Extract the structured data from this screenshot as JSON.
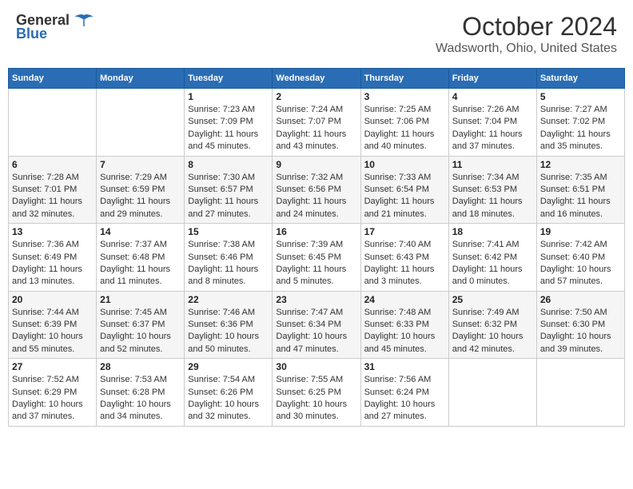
{
  "header": {
    "logo_general": "General",
    "logo_blue": "Blue",
    "month": "October 2024",
    "location": "Wadsworth, Ohio, United States"
  },
  "weekdays": [
    "Sunday",
    "Monday",
    "Tuesday",
    "Wednesday",
    "Thursday",
    "Friday",
    "Saturday"
  ],
  "weeks": [
    [
      null,
      null,
      {
        "day": "1",
        "sunrise": "7:23 AM",
        "sunset": "7:09 PM",
        "daylight": "11 hours and 45 minutes."
      },
      {
        "day": "2",
        "sunrise": "7:24 AM",
        "sunset": "7:07 PM",
        "daylight": "11 hours and 43 minutes."
      },
      {
        "day": "3",
        "sunrise": "7:25 AM",
        "sunset": "7:06 PM",
        "daylight": "11 hours and 40 minutes."
      },
      {
        "day": "4",
        "sunrise": "7:26 AM",
        "sunset": "7:04 PM",
        "daylight": "11 hours and 37 minutes."
      },
      {
        "day": "5",
        "sunrise": "7:27 AM",
        "sunset": "7:02 PM",
        "daylight": "11 hours and 35 minutes."
      }
    ],
    [
      {
        "day": "6",
        "sunrise": "7:28 AM",
        "sunset": "7:01 PM",
        "daylight": "11 hours and 32 minutes."
      },
      {
        "day": "7",
        "sunrise": "7:29 AM",
        "sunset": "6:59 PM",
        "daylight": "11 hours and 29 minutes."
      },
      {
        "day": "8",
        "sunrise": "7:30 AM",
        "sunset": "6:57 PM",
        "daylight": "11 hours and 27 minutes."
      },
      {
        "day": "9",
        "sunrise": "7:32 AM",
        "sunset": "6:56 PM",
        "daylight": "11 hours and 24 minutes."
      },
      {
        "day": "10",
        "sunrise": "7:33 AM",
        "sunset": "6:54 PM",
        "daylight": "11 hours and 21 minutes."
      },
      {
        "day": "11",
        "sunrise": "7:34 AM",
        "sunset": "6:53 PM",
        "daylight": "11 hours and 18 minutes."
      },
      {
        "day": "12",
        "sunrise": "7:35 AM",
        "sunset": "6:51 PM",
        "daylight": "11 hours and 16 minutes."
      }
    ],
    [
      {
        "day": "13",
        "sunrise": "7:36 AM",
        "sunset": "6:49 PM",
        "daylight": "11 hours and 13 minutes."
      },
      {
        "day": "14",
        "sunrise": "7:37 AM",
        "sunset": "6:48 PM",
        "daylight": "11 hours and 11 minutes."
      },
      {
        "day": "15",
        "sunrise": "7:38 AM",
        "sunset": "6:46 PM",
        "daylight": "11 hours and 8 minutes."
      },
      {
        "day": "16",
        "sunrise": "7:39 AM",
        "sunset": "6:45 PM",
        "daylight": "11 hours and 5 minutes."
      },
      {
        "day": "17",
        "sunrise": "7:40 AM",
        "sunset": "6:43 PM",
        "daylight": "11 hours and 3 minutes."
      },
      {
        "day": "18",
        "sunrise": "7:41 AM",
        "sunset": "6:42 PM",
        "daylight": "11 hours and 0 minutes."
      },
      {
        "day": "19",
        "sunrise": "7:42 AM",
        "sunset": "6:40 PM",
        "daylight": "10 hours and 57 minutes."
      }
    ],
    [
      {
        "day": "20",
        "sunrise": "7:44 AM",
        "sunset": "6:39 PM",
        "daylight": "10 hours and 55 minutes."
      },
      {
        "day": "21",
        "sunrise": "7:45 AM",
        "sunset": "6:37 PM",
        "daylight": "10 hours and 52 minutes."
      },
      {
        "day": "22",
        "sunrise": "7:46 AM",
        "sunset": "6:36 PM",
        "daylight": "10 hours and 50 minutes."
      },
      {
        "day": "23",
        "sunrise": "7:47 AM",
        "sunset": "6:34 PM",
        "daylight": "10 hours and 47 minutes."
      },
      {
        "day": "24",
        "sunrise": "7:48 AM",
        "sunset": "6:33 PM",
        "daylight": "10 hours and 45 minutes."
      },
      {
        "day": "25",
        "sunrise": "7:49 AM",
        "sunset": "6:32 PM",
        "daylight": "10 hours and 42 minutes."
      },
      {
        "day": "26",
        "sunrise": "7:50 AM",
        "sunset": "6:30 PM",
        "daylight": "10 hours and 39 minutes."
      }
    ],
    [
      {
        "day": "27",
        "sunrise": "7:52 AM",
        "sunset": "6:29 PM",
        "daylight": "10 hours and 37 minutes."
      },
      {
        "day": "28",
        "sunrise": "7:53 AM",
        "sunset": "6:28 PM",
        "daylight": "10 hours and 34 minutes."
      },
      {
        "day": "29",
        "sunrise": "7:54 AM",
        "sunset": "6:26 PM",
        "daylight": "10 hours and 32 minutes."
      },
      {
        "day": "30",
        "sunrise": "7:55 AM",
        "sunset": "6:25 PM",
        "daylight": "10 hours and 30 minutes."
      },
      {
        "day": "31",
        "sunrise": "7:56 AM",
        "sunset": "6:24 PM",
        "daylight": "10 hours and 27 minutes."
      },
      null,
      null
    ]
  ],
  "labels": {
    "sunrise": "Sunrise:",
    "sunset": "Sunset:",
    "daylight": "Daylight:"
  }
}
